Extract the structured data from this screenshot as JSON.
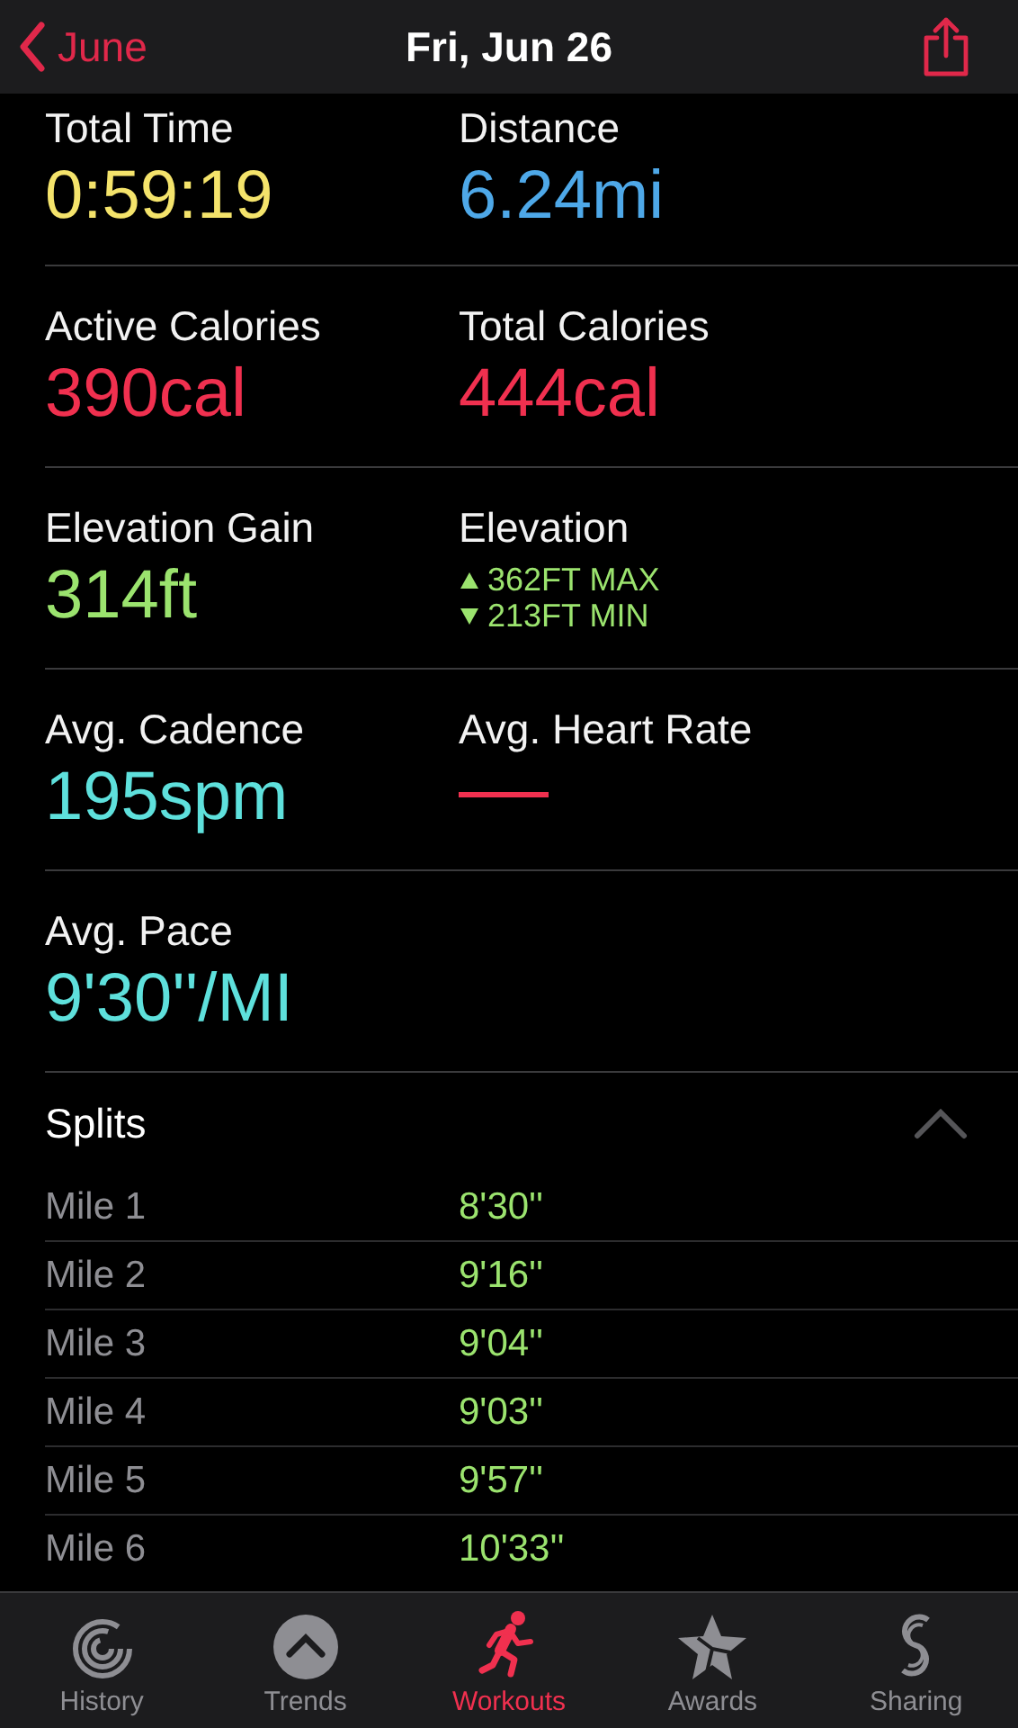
{
  "nav": {
    "back": "June",
    "title": "Fri, Jun 26"
  },
  "metric_rows": [
    [
      {
        "kind": "value",
        "label": "Total Time",
        "value": "0:59:19",
        "color": "#f4e36b"
      },
      {
        "kind": "value",
        "label": "Distance",
        "value": "6.24mi",
        "color": "#4ea8e8"
      }
    ],
    [
      {
        "kind": "value",
        "label": "Active Calories",
        "value": "390cal",
        "color": "#f0304f"
      },
      {
        "kind": "value",
        "label": "Total Calories",
        "value": "444cal",
        "color": "#f0304f"
      }
    ],
    [
      {
        "kind": "value",
        "label": "Elevation Gain",
        "value": "314ft",
        "color": "#9be36e"
      },
      {
        "kind": "range",
        "label": "Elevation",
        "max": "362FT MAX",
        "min": "213FT MIN",
        "color": "#9be36e"
      }
    ],
    [
      {
        "kind": "value",
        "label": "Avg. Cadence",
        "value": "195spm",
        "color": "#5ee0dc"
      },
      {
        "kind": "dash",
        "label": "Avg. Heart Rate",
        "color": "#f0304f"
      }
    ],
    [
      {
        "kind": "value",
        "label": "Avg. Pace",
        "value": "9'30''/MI",
        "color": "#5ee0dc"
      }
    ]
  ],
  "splits": {
    "title": "Splits",
    "expanded": true,
    "rows": [
      {
        "label": "Mile 1",
        "pace": "8'30''"
      },
      {
        "label": "Mile 2",
        "pace": "9'16''"
      },
      {
        "label": "Mile 3",
        "pace": "9'04''"
      },
      {
        "label": "Mile 4",
        "pace": "9'03''"
      },
      {
        "label": "Mile 5",
        "pace": "9'57''"
      },
      {
        "label": "Mile 6",
        "pace": "10'33''"
      }
    ]
  },
  "tabs": [
    {
      "label": "History",
      "selected": false
    },
    {
      "label": "Trends",
      "selected": false
    },
    {
      "label": "Workouts",
      "selected": true
    },
    {
      "label": "Awards",
      "selected": false
    },
    {
      "label": "Sharing",
      "selected": false
    }
  ]
}
